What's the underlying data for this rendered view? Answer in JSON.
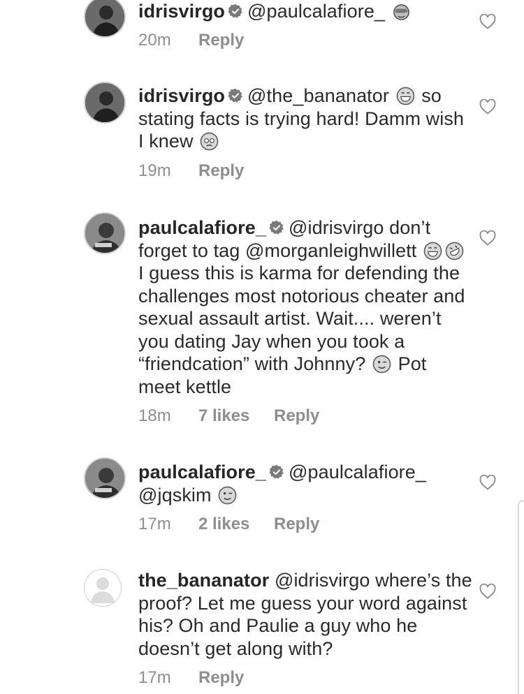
{
  "comments": [
    {
      "username": "idrisvirgo",
      "verified": true,
      "text_parts": [
        "@paulcalafiore_"
      ],
      "time": "20m",
      "likes": "",
      "reply_label": "Reply",
      "emoji_icons": [
        "see-no-evil-monkey-icon"
      ]
    },
    {
      "username": "idrisvirgo",
      "verified": true,
      "text_parts": [
        "@the_bananator",
        " so stating facts is trying hard! Damm wish I knew"
      ],
      "time": "19m",
      "likes": "",
      "reply_label": "Reply",
      "emoji_icons": [
        "grinning-sweat-icon",
        "pleading-face-icon"
      ]
    },
    {
      "username": "paulcalafiore_",
      "verified": true,
      "text_parts": [
        "@idrisvirgo don’t forget to tag @morganleighwillett",
        " I guess this is karma for defending the challenges most notorious cheater and sexual assault artist. Wait.... weren’t you dating Jay when you took a “friendcation” with Johnny?",
        " Pot meet kettle"
      ],
      "time": "18m",
      "likes": "7 likes",
      "reply_label": "Reply",
      "emoji_icons": [
        "grinning-sweat-icon",
        "rolling-laughing-icon",
        "winking-face-icon"
      ]
    },
    {
      "username": "paulcalafiore_",
      "verified": true,
      "text_parts": [
        "@paulcalafiore_ @jqskim"
      ],
      "time": "17m",
      "likes": "2 likes",
      "reply_label": "Reply",
      "emoji_icons": [
        "winking-face-icon"
      ]
    },
    {
      "username": "the_bananator",
      "verified": false,
      "text_parts": [
        "@idrisvirgo where’s the proof? Let me guess your word against his? Oh and Paulie a guy who he doesn’t get along with?"
      ],
      "time": "17m",
      "likes": "",
      "reply_label": "Reply",
      "emoji_icons": []
    }
  ]
}
